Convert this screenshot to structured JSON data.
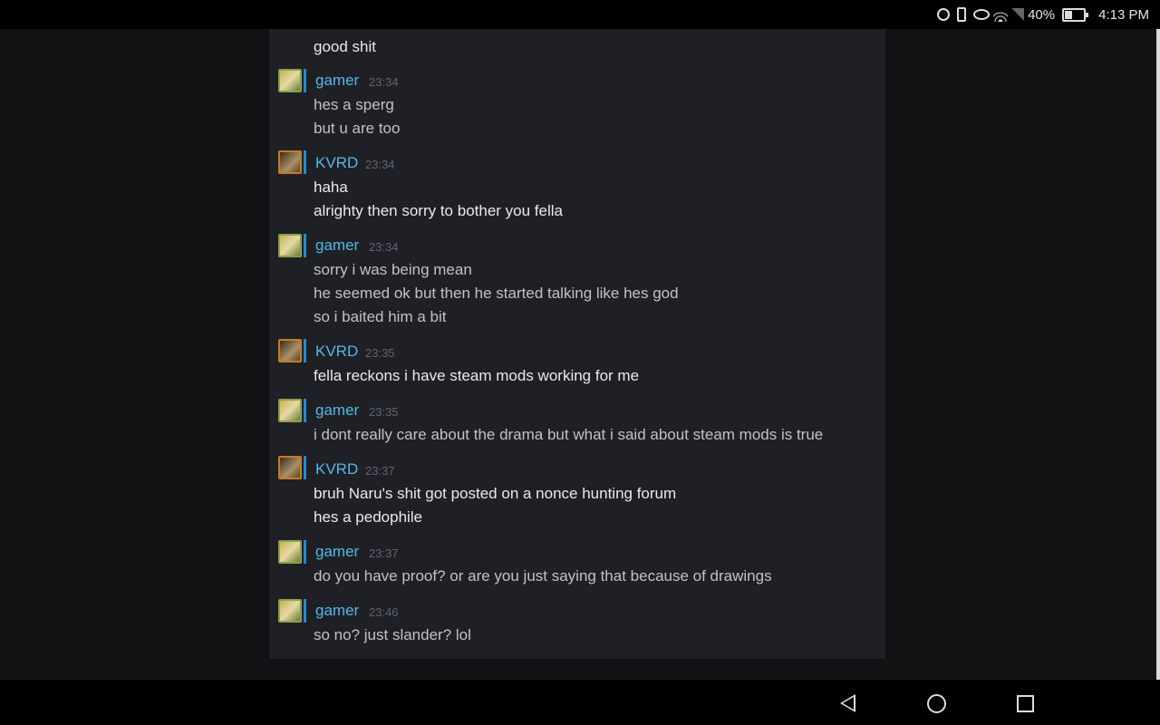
{
  "status_bar": {
    "battery_percent": "40%",
    "clock": "4:13 PM",
    "icons": [
      "alarm-icon",
      "vibrate-icon",
      "eye-comfort-icon",
      "wifi-icon",
      "signal-icon",
      "battery-icon"
    ]
  },
  "chat": {
    "partial_top_line": "good shit",
    "groups": [
      {
        "author": "gamer",
        "avatar": "gamer-avatar",
        "time": "23:34",
        "lines": [
          "hes a sperg",
          "but u are too"
        ]
      },
      {
        "author": "KVRD",
        "avatar": "kvrd-avatar",
        "time": "23:34",
        "lines": [
          "haha",
          "alrighty then sorry to bother you fella"
        ]
      },
      {
        "author": "gamer",
        "avatar": "gamer-avatar",
        "time": "23:34",
        "lines": [
          "sorry i was being mean",
          "he seemed ok but then he started talking like hes god",
          "so i baited him a bit"
        ]
      },
      {
        "author": "KVRD",
        "avatar": "kvrd-avatar",
        "time": "23:35",
        "lines": [
          "fella reckons i have steam mods working for me"
        ]
      },
      {
        "author": "gamer",
        "avatar": "gamer-avatar",
        "time": "23:35",
        "lines": [
          "i dont really care about the drama but what i said about steam mods is true"
        ]
      },
      {
        "author": "KVRD",
        "avatar": "kvrd-avatar",
        "time": "23:37",
        "lines": [
          "bruh Naru's shit got posted on a nonce hunting forum",
          "hes a pedophile"
        ]
      },
      {
        "author": "gamer",
        "avatar": "gamer-avatar",
        "time": "23:37",
        "lines": [
          "do you have proof? or are you just saying that because of drawings"
        ]
      },
      {
        "author": "gamer",
        "avatar": "gamer-avatar",
        "time": "23:46",
        "lines": [
          "so no? just slander? lol"
        ]
      }
    ]
  },
  "nav_bar": {
    "buttons": [
      "back-button",
      "home-button",
      "recents-button"
    ]
  }
}
